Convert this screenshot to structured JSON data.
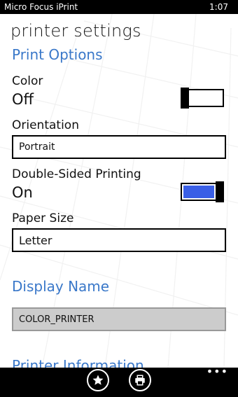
{
  "status_bar": {
    "app_name": "Micro Focus iPrint",
    "time": "1:07"
  },
  "page": {
    "title": "printer settings"
  },
  "print_options": {
    "header": "Print Options",
    "color": {
      "label": "Color",
      "state": "Off",
      "enabled": false
    },
    "orientation": {
      "label": "Orientation",
      "value": "Portrait"
    },
    "double_sided": {
      "label": "Double-Sided Printing",
      "state": "On",
      "enabled": true
    },
    "paper_size": {
      "label": "Paper Size",
      "value": "Letter"
    }
  },
  "display_name": {
    "header": "Display Name",
    "value": "COLOR_PRINTER"
  },
  "printer_info": {
    "header": "Printer Information"
  },
  "app_bar": {
    "buttons": [
      {
        "icon": "star-icon"
      },
      {
        "icon": "printer-icon"
      }
    ],
    "more": "•••"
  },
  "colors": {
    "accent": "#3a78c9",
    "toggle_on": "#3a5fe6",
    "readonly_field": "#cccccc"
  }
}
